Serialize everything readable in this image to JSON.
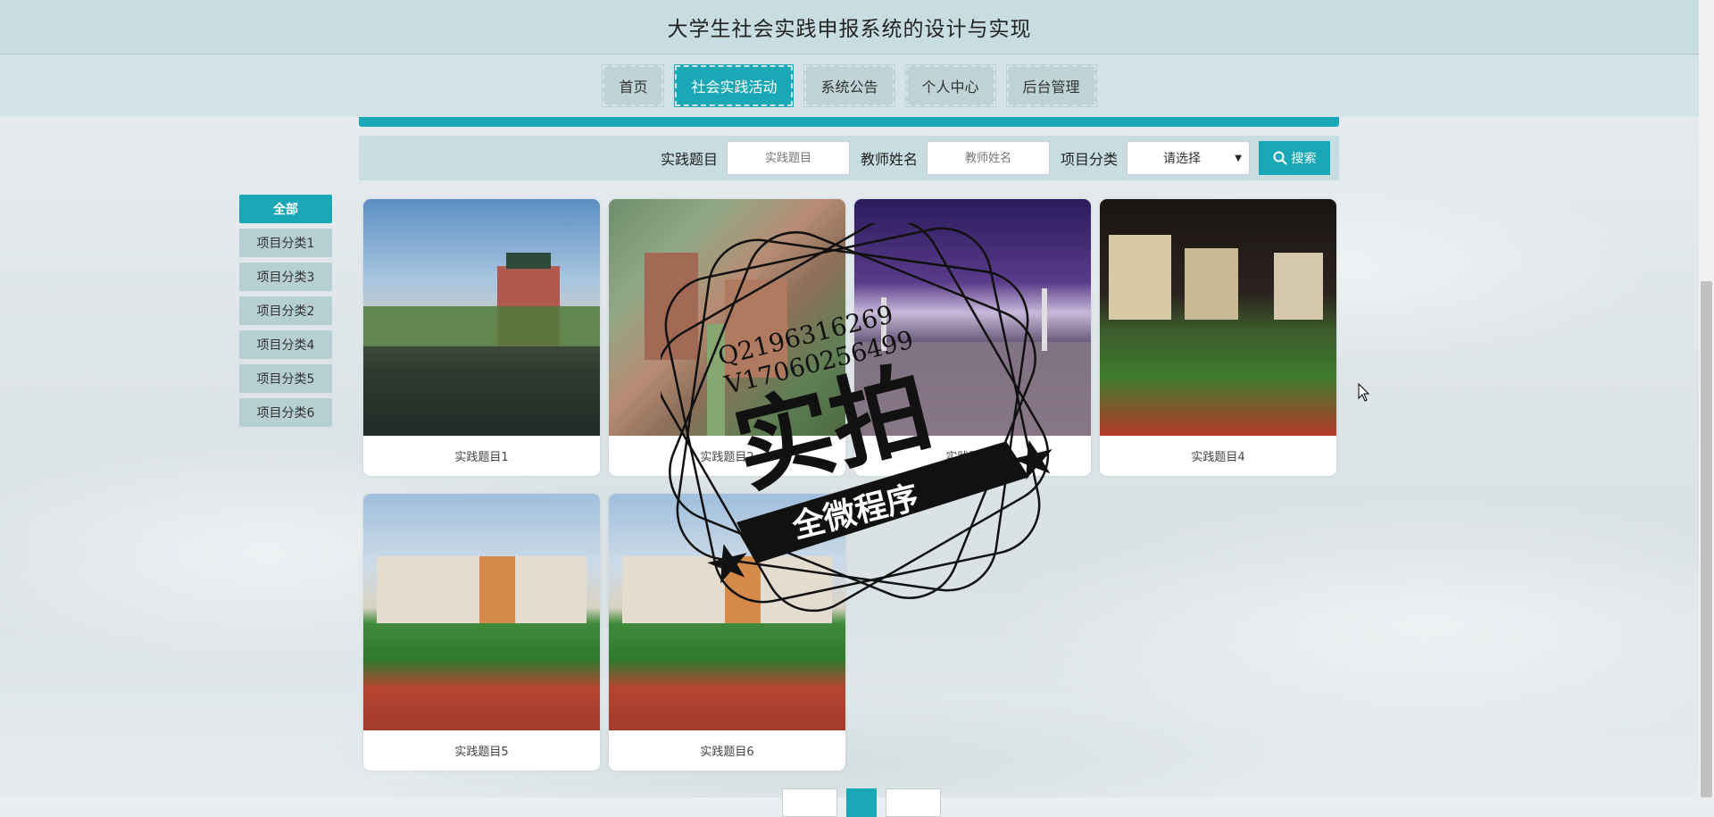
{
  "header": {
    "title": "大学生社会实践申报系统的设计与实现"
  },
  "nav": {
    "items": [
      {
        "label": "首页",
        "active": false
      },
      {
        "label": "社会实践活动",
        "active": true
      },
      {
        "label": "系统公告",
        "active": false
      },
      {
        "label": "个人中心",
        "active": false
      },
      {
        "label": "后台管理",
        "active": false
      }
    ]
  },
  "search": {
    "topic_label": "实践题目",
    "topic_placeholder": "实践题目",
    "teacher_label": "教师姓名",
    "teacher_placeholder": "教师姓名",
    "category_label": "项目分类",
    "category_selected": "请选择",
    "button_label": "搜索"
  },
  "sidebar": {
    "items": [
      {
        "label": "全部",
        "active": true
      },
      {
        "label": "项目分类1"
      },
      {
        "label": "项目分类3"
      },
      {
        "label": "项目分类2"
      },
      {
        "label": "项目分类4"
      },
      {
        "label": "项目分类5"
      },
      {
        "label": "项目分类6"
      }
    ]
  },
  "cards": [
    {
      "title": "实践题目1",
      "image": "lake-campus-building"
    },
    {
      "title": "实践题目2",
      "image": "aerial-campus"
    },
    {
      "title": "实践题目3",
      "image": "night-sports-court"
    },
    {
      "title": "实践题目4",
      "image": "night-football-field"
    },
    {
      "title": "实践题目5",
      "image": "stadium-building"
    },
    {
      "title": "实践题目6",
      "image": "stadium-building"
    }
  ],
  "watermark": {
    "line1": "Q2196316269",
    "line2": "V17060256499",
    "main": "实拍",
    "ribbon": "全微程序"
  },
  "colors": {
    "accent": "#1aa7b6",
    "header_bg": "#c7dde1",
    "nav_bg": "#d4e3e8"
  }
}
